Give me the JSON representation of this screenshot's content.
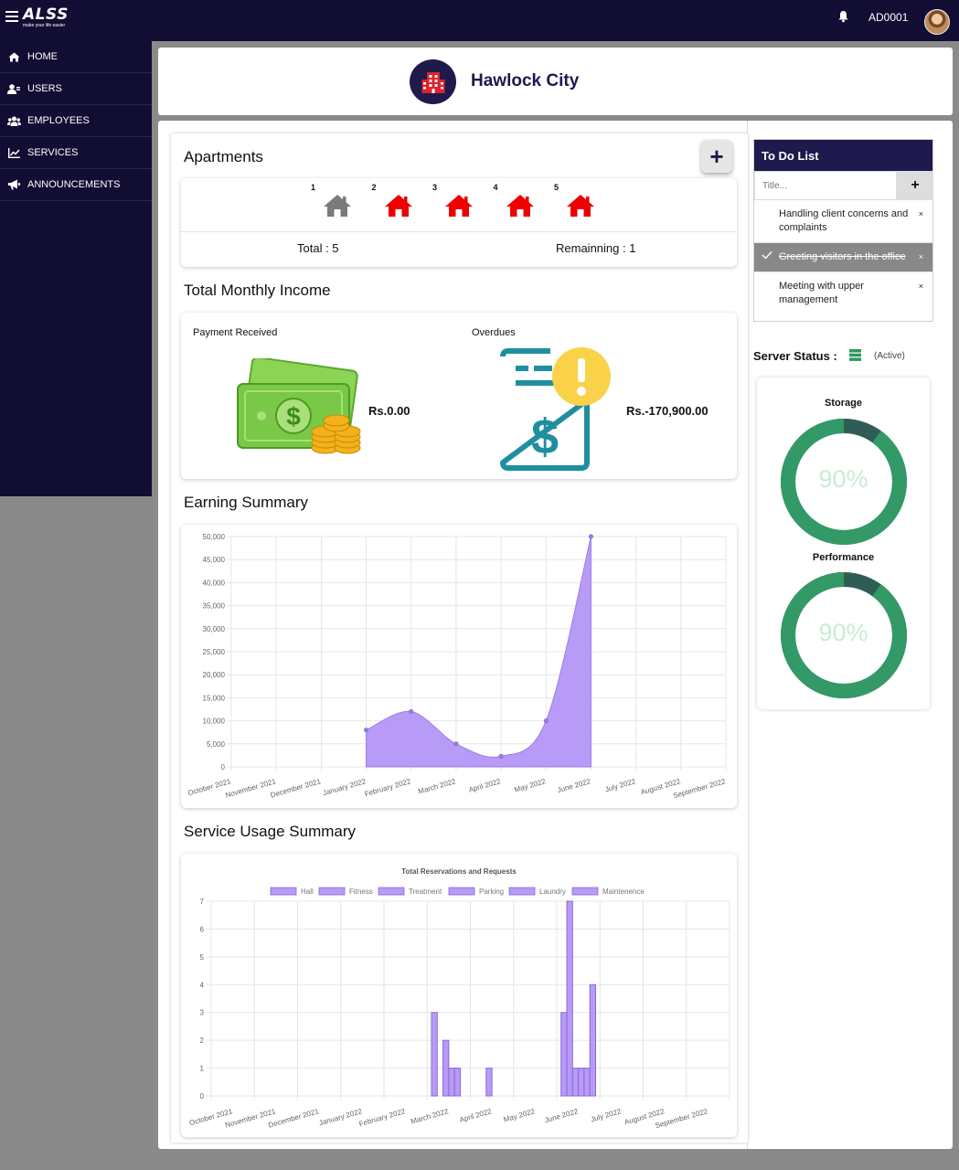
{
  "topbar": {
    "logo_text": "ALSS",
    "logo_tagline": "make your life easier",
    "user_id": "AD0001"
  },
  "sidebar": {
    "items": [
      {
        "label": "HOME",
        "icon": "home-icon"
      },
      {
        "label": "USERS",
        "icon": "user-icon"
      },
      {
        "label": "EMPLOYEES",
        "icon": "users-group-icon"
      },
      {
        "label": "SERVICES",
        "icon": "chart-line-icon"
      },
      {
        "label": "ANNOUNCEMENTS",
        "icon": "megaphone-icon"
      }
    ]
  },
  "header": {
    "city_name": "Hawlock City"
  },
  "apartments": {
    "title": "Apartments",
    "add_label": "+",
    "units": [
      {
        "number": "1",
        "status": "available"
      },
      {
        "number": "2",
        "status": "occupied"
      },
      {
        "number": "3",
        "status": "occupied"
      },
      {
        "number": "4",
        "status": "occupied"
      },
      {
        "number": "5",
        "status": "occupied"
      }
    ],
    "total_text": "Total : 5",
    "remaining_text": "Remainning : 1",
    "colors": {
      "available": "#7a7a7a",
      "occupied": "#ee0000"
    }
  },
  "income": {
    "title": "Total Monthly Income",
    "payment_label": "Payment Received",
    "payment_value": "Rs.0.00",
    "overdue_label": "Overdues",
    "overdue_value": "Rs.-170,900.00"
  },
  "earning": {
    "title": "Earning Summary",
    "chart_data": {
      "type": "area",
      "categories": [
        "October 2021",
        "November 2021",
        "December 2021",
        "January 2022",
        "February 2022",
        "March 2022",
        "April 2022",
        "May 2022",
        "June 2022",
        "July 2022",
        "August 2022",
        "September 2022"
      ],
      "values": [
        null,
        null,
        null,
        8000,
        12000,
        5000,
        2300,
        10000,
        50000,
        null,
        null,
        null
      ],
      "ylim": [
        0,
        50000
      ],
      "yticks": [
        "0",
        "5,000",
        "10,000",
        "15,000",
        "20,000",
        "25,000",
        "30,000",
        "35,000",
        "40,000",
        "45,000",
        "50,000"
      ],
      "fill_color": "#b89af7",
      "grid": true
    }
  },
  "service_usage": {
    "title": "Service Usage Summary",
    "chart_data": {
      "type": "bar",
      "title": "Total Reservations and Requests",
      "categories": [
        "October 2021",
        "November 2021",
        "December 2021",
        "January 2022",
        "February 2022",
        "March 2022",
        "April 2022",
        "May 2022",
        "June 2022",
        "July 2022",
        "August 2022",
        "September 2022"
      ],
      "series": [
        {
          "name": "Hall",
          "values": [
            0,
            0,
            0,
            0,
            0,
            3,
            0,
            0,
            3,
            0,
            0,
            0
          ]
        },
        {
          "name": "Fitness",
          "values": [
            0,
            0,
            0,
            0,
            0,
            0,
            0,
            0,
            7,
            0,
            0,
            0
          ]
        },
        {
          "name": "Treatment",
          "values": [
            0,
            0,
            0,
            0,
            0,
            2,
            1,
            0,
            1,
            0,
            0,
            0
          ]
        },
        {
          "name": "Parking",
          "values": [
            0,
            0,
            0,
            0,
            0,
            1,
            0,
            0,
            1,
            0,
            0,
            0
          ]
        },
        {
          "name": "Laundry",
          "values": [
            0,
            0,
            0,
            0,
            0,
            1,
            0,
            0,
            1,
            0,
            0,
            0
          ]
        },
        {
          "name": "Maintenence",
          "values": [
            0,
            0,
            0,
            0,
            0,
            0,
            0,
            0,
            4,
            0,
            0,
            0
          ]
        }
      ],
      "ylim": [
        0,
        7
      ],
      "yticks": [
        "0",
        "1",
        "2",
        "3",
        "4",
        "5",
        "6",
        "7"
      ],
      "bar_color": "#b89af7",
      "bar_border": "#8a6ad8",
      "legend": "top",
      "grid": true
    }
  },
  "todo": {
    "title": "To Do List",
    "input_placeholder": "Title...",
    "add_label": "+",
    "items": [
      {
        "text": "Handling client concerns and complaints",
        "done": false
      },
      {
        "text": "Greeting visitors in the office",
        "done": true
      },
      {
        "text": "Meeting with upper management",
        "done": false
      }
    ],
    "close_label": "×"
  },
  "server": {
    "label": "Server Status :",
    "state": "(Active)",
    "storage_label": "Storage",
    "storage_value": "90%",
    "storage_fraction": 0.9,
    "performance_label": "Performance",
    "performance_value": "90%",
    "performance_fraction": 0.9,
    "colors": {
      "ring": "#339966",
      "ring_rest": "#2f5d56",
      "icon": "#2a9a5a"
    }
  }
}
